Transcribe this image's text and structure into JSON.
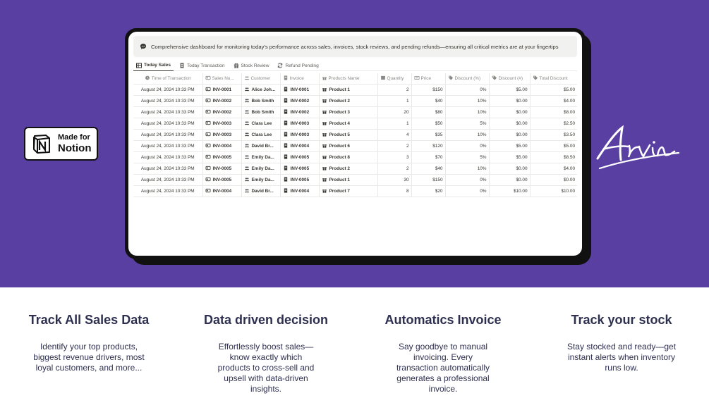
{
  "badge": {
    "small": "Made for",
    "big": "Notion"
  },
  "signature": {
    "text": "Arvin"
  },
  "callout": {
    "text": "Comprehensive dashboard for monitoring today's performance across sales, invoices, stock reviews, and pending refunds—ensuring all critical metrics are at your fingertips"
  },
  "tabs": [
    {
      "label": "Today Sales",
      "icon": "table-icon",
      "active": true
    },
    {
      "label": "Today Transaction",
      "icon": "document-icon",
      "active": false
    },
    {
      "label": "Stock Review",
      "icon": "gift-icon",
      "active": false
    },
    {
      "label": "Refund Pending",
      "icon": "refresh-icon",
      "active": false
    }
  ],
  "table": {
    "headers": [
      "Time of Transaction",
      "Sales Nu...",
      "Customer",
      "Invoice",
      "Products Name",
      "Quantity",
      "Price",
      "Discount (%)",
      "Discount (#)",
      "Total Discount"
    ],
    "rows": [
      [
        "August 24, 2024 10:33 PM",
        "INV-0001",
        "Alice Joh...",
        "INV-0001",
        "Product 1",
        "2",
        "$150",
        "0%",
        "$5.00",
        "$5.00"
      ],
      [
        "August 24, 2024 10:33 PM",
        "INV-0002",
        "Bob Smith",
        "INV-0002",
        "Product 2",
        "1",
        "$40",
        "10%",
        "$0.00",
        "$4.00"
      ],
      [
        "August 24, 2024 10:33 PM",
        "INV-0002",
        "Bob Smith",
        "INV-0002",
        "Product 3",
        "20",
        "$80",
        "10%",
        "$0.00",
        "$8.00"
      ],
      [
        "August 24, 2024 10:33 PM",
        "INV-0003",
        "Clara Lee",
        "INV-0003",
        "Product 4",
        "1",
        "$50",
        "5%",
        "$0.00",
        "$2.50"
      ],
      [
        "August 24, 2024 10:33 PM",
        "INV-0003",
        "Clara Lee",
        "INV-0003",
        "Product 5",
        "4",
        "$35",
        "10%",
        "$0.00",
        "$3.50"
      ],
      [
        "August 24, 2024 10:33 PM",
        "INV-0004",
        "David Br...",
        "INV-0004",
        "Product 6",
        "2",
        "$120",
        "0%",
        "$5.00",
        "$5.00"
      ],
      [
        "August 24, 2024 10:33 PM",
        "INV-0005",
        "Emily Da...",
        "INV-0005",
        "Product 8",
        "3",
        "$70",
        "5%",
        "$5.00",
        "$8.50"
      ],
      [
        "August 24, 2024 10:33 PM",
        "INV-0005",
        "Emily Da...",
        "INV-0005",
        "Product 2",
        "2",
        "$40",
        "10%",
        "$0.00",
        "$4.00"
      ],
      [
        "August 24, 2024 10:33 PM",
        "INV-0005",
        "Emily Da...",
        "INV-0005",
        "Product 1",
        "30",
        "$150",
        "0%",
        "$0.00",
        "$0.00"
      ],
      [
        "August 24, 2024 10:33 PM",
        "INV-0004",
        "David Br...",
        "INV-0004",
        "Product 7",
        "8",
        "$20",
        "0%",
        "$10.00",
        "$10.00"
      ]
    ]
  },
  "features": [
    {
      "title": "Track All Sales Data",
      "desc": "Identify your top products, biggest revenue drivers, most loyal customers, and more..."
    },
    {
      "title": "Data driven decision",
      "desc": "Effortlessly boost sales—know exactly which products to cross-sell and upsell with data-driven insights."
    },
    {
      "title": "Automatics Invoice",
      "desc": "Say goodbye to manual invoicing. Every transaction automatically generates a professional invoice."
    },
    {
      "title": "Track your stock",
      "desc": "Stay stocked and ready—get instant alerts when inventory runs low."
    }
  ],
  "colors": {
    "hero": "#5a3fa3",
    "heading": "#2e3050"
  }
}
